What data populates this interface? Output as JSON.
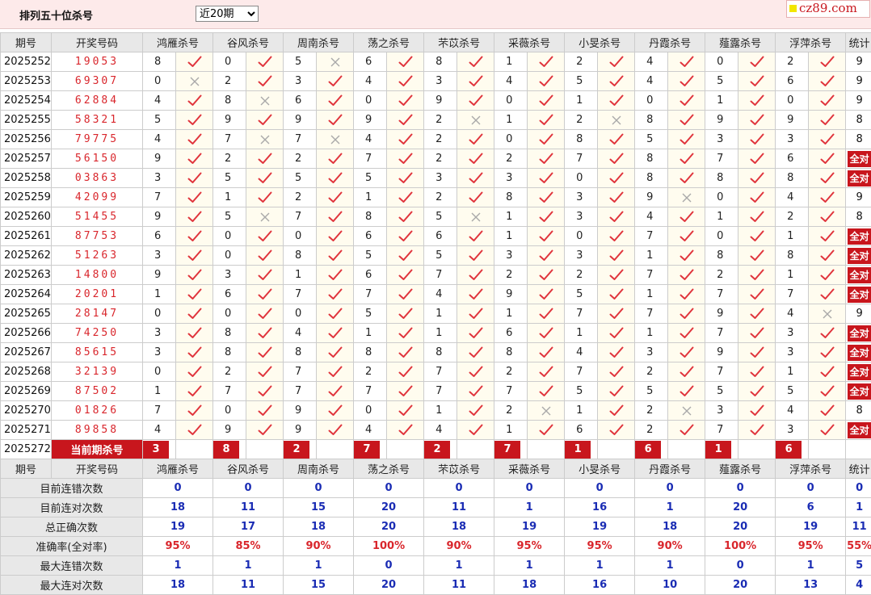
{
  "page": {
    "title": "排列五十位杀号",
    "period_select": "近20期",
    "site": "cz89.com"
  },
  "headers": {
    "period": "期号",
    "number": "开奖号码",
    "experts": [
      "鸿雁杀号",
      "谷风杀号",
      "周南杀号",
      "荡之杀号",
      "芣苡杀号",
      "采薇杀号",
      "小旻杀号",
      "丹霞杀号",
      "薤露杀号",
      "浮萍杀号"
    ],
    "stat": "统计"
  },
  "rows": [
    {
      "period": "2025252",
      "number": "19053",
      "kills": [
        8,
        0,
        5,
        6,
        8,
        1,
        2,
        4,
        0,
        2
      ],
      "hits": [
        1,
        1,
        0,
        1,
        1,
        1,
        1,
        1,
        1,
        1
      ],
      "stat": "9"
    },
    {
      "period": "2025253",
      "number": "69307",
      "kills": [
        0,
        2,
        3,
        4,
        3,
        4,
        5,
        4,
        5,
        6
      ],
      "hits": [
        0,
        1,
        1,
        1,
        1,
        1,
        1,
        1,
        1,
        1
      ],
      "stat": "9"
    },
    {
      "period": "2025254",
      "number": "62884",
      "kills": [
        4,
        8,
        6,
        0,
        9,
        0,
        1,
        0,
        1,
        0
      ],
      "hits": [
        1,
        0,
        1,
        1,
        1,
        1,
        1,
        1,
        1,
        1
      ],
      "stat": "9"
    },
    {
      "period": "2025255",
      "number": "58321",
      "kills": [
        5,
        9,
        9,
        9,
        2,
        1,
        2,
        8,
        9,
        9
      ],
      "hits": [
        1,
        1,
        1,
        1,
        0,
        1,
        0,
        1,
        1,
        1
      ],
      "stat": "8"
    },
    {
      "period": "2025256",
      "number": "79775",
      "kills": [
        4,
        7,
        7,
        4,
        2,
        0,
        8,
        5,
        3,
        3
      ],
      "hits": [
        1,
        0,
        0,
        1,
        1,
        1,
        1,
        1,
        1,
        1
      ],
      "stat": "8"
    },
    {
      "period": "2025257",
      "number": "56150",
      "kills": [
        9,
        2,
        2,
        7,
        2,
        2,
        7,
        8,
        7,
        6
      ],
      "hits": [
        1,
        1,
        1,
        1,
        1,
        1,
        1,
        1,
        1,
        1
      ],
      "stat": "全对"
    },
    {
      "period": "2025258",
      "number": "03863",
      "kills": [
        3,
        5,
        5,
        5,
        3,
        3,
        0,
        8,
        8,
        8
      ],
      "hits": [
        1,
        1,
        1,
        1,
        1,
        1,
        1,
        1,
        1,
        1
      ],
      "stat": "全对"
    },
    {
      "period": "2025259",
      "number": "42099",
      "kills": [
        7,
        1,
        2,
        1,
        2,
        8,
        3,
        9,
        0,
        4
      ],
      "hits": [
        1,
        1,
        1,
        1,
        1,
        1,
        1,
        0,
        1,
        1
      ],
      "stat": "9"
    },
    {
      "period": "2025260",
      "number": "51455",
      "kills": [
        9,
        5,
        7,
        8,
        5,
        1,
        3,
        4,
        1,
        2
      ],
      "hits": [
        1,
        0,
        1,
        1,
        0,
        1,
        1,
        1,
        1,
        1
      ],
      "stat": "8"
    },
    {
      "period": "2025261",
      "number": "87753",
      "kills": [
        6,
        0,
        0,
        6,
        6,
        1,
        0,
        7,
        0,
        1
      ],
      "hits": [
        1,
        1,
        1,
        1,
        1,
        1,
        1,
        1,
        1,
        1
      ],
      "stat": "全对"
    },
    {
      "period": "2025262",
      "number": "51263",
      "kills": [
        3,
        0,
        8,
        5,
        5,
        3,
        3,
        1,
        8,
        8
      ],
      "hits": [
        1,
        1,
        1,
        1,
        1,
        1,
        1,
        1,
        1,
        1
      ],
      "stat": "全对"
    },
    {
      "period": "2025263",
      "number": "14800",
      "kills": [
        9,
        3,
        1,
        6,
        7,
        2,
        2,
        7,
        2,
        1
      ],
      "hits": [
        1,
        1,
        1,
        1,
        1,
        1,
        1,
        1,
        1,
        1
      ],
      "stat": "全对"
    },
    {
      "period": "2025264",
      "number": "20201",
      "kills": [
        1,
        6,
        7,
        7,
        4,
        9,
        5,
        1,
        7,
        7
      ],
      "hits": [
        1,
        1,
        1,
        1,
        1,
        1,
        1,
        1,
        1,
        1
      ],
      "stat": "全对"
    },
    {
      "period": "2025265",
      "number": "28147",
      "kills": [
        0,
        0,
        0,
        5,
        1,
        1,
        7,
        7,
        9,
        4
      ],
      "hits": [
        1,
        1,
        1,
        1,
        1,
        1,
        1,
        1,
        1,
        0
      ],
      "stat": "9"
    },
    {
      "period": "2025266",
      "number": "74250",
      "kills": [
        3,
        8,
        4,
        1,
        1,
        6,
        1,
        1,
        7,
        3
      ],
      "hits": [
        1,
        1,
        1,
        1,
        1,
        1,
        1,
        1,
        1,
        1
      ],
      "stat": "全对"
    },
    {
      "period": "2025267",
      "number": "85615",
      "kills": [
        3,
        8,
        8,
        8,
        8,
        8,
        4,
        3,
        9,
        3
      ],
      "hits": [
        1,
        1,
        1,
        1,
        1,
        1,
        1,
        1,
        1,
        1
      ],
      "stat": "全对"
    },
    {
      "period": "2025268",
      "number": "32139",
      "kills": [
        0,
        2,
        7,
        2,
        7,
        2,
        7,
        2,
        7,
        1
      ],
      "hits": [
        1,
        1,
        1,
        1,
        1,
        1,
        1,
        1,
        1,
        1
      ],
      "stat": "全对"
    },
    {
      "period": "2025269",
      "number": "87502",
      "kills": [
        1,
        7,
        7,
        7,
        7,
        7,
        5,
        5,
        5,
        5
      ],
      "hits": [
        1,
        1,
        1,
        1,
        1,
        1,
        1,
        1,
        1,
        1
      ],
      "stat": "全对"
    },
    {
      "period": "2025270",
      "number": "01826",
      "kills": [
        7,
        0,
        9,
        0,
        1,
        2,
        1,
        2,
        3,
        4
      ],
      "hits": [
        1,
        1,
        1,
        1,
        1,
        0,
        1,
        0,
        1,
        1
      ],
      "stat": "8"
    },
    {
      "period": "2025271",
      "number": "89858",
      "kills": [
        4,
        9,
        9,
        4,
        4,
        1,
        6,
        2,
        7,
        3
      ],
      "hits": [
        1,
        1,
        1,
        1,
        1,
        1,
        1,
        1,
        1,
        1
      ],
      "stat": "全对"
    }
  ],
  "current": {
    "period": "2025272",
    "label": "当前期杀号",
    "kills": [
      3,
      8,
      2,
      7,
      2,
      7,
      1,
      6,
      1,
      6
    ]
  },
  "stats": [
    {
      "label": "目前连错次数",
      "values": [
        "0",
        "0",
        "0",
        "0",
        "0",
        "0",
        "0",
        "0",
        "0",
        "0",
        "0"
      ],
      "tone": "b"
    },
    {
      "label": "目前连对次数",
      "values": [
        "18",
        "11",
        "15",
        "20",
        "11",
        "1",
        "16",
        "1",
        "20",
        "6",
        "1"
      ],
      "tone": "b"
    },
    {
      "label": "总正确次数",
      "values": [
        "19",
        "17",
        "18",
        "20",
        "18",
        "19",
        "19",
        "18",
        "20",
        "19",
        "11"
      ],
      "tone": "b"
    },
    {
      "label": "准确率(全对率)",
      "values": [
        "95%",
        "85%",
        "90%",
        "100%",
        "90%",
        "95%",
        "95%",
        "90%",
        "100%",
        "95%",
        "55%"
      ],
      "tone": "r"
    },
    {
      "label": "最大连错次数",
      "values": [
        "1",
        "1",
        "1",
        "0",
        "1",
        "1",
        "1",
        "1",
        "0",
        "1",
        "5"
      ],
      "tone": "b"
    },
    {
      "label": "最大连对次数",
      "values": [
        "18",
        "11",
        "15",
        "20",
        "11",
        "18",
        "16",
        "10",
        "20",
        "13",
        "4"
      ],
      "tone": "b"
    }
  ],
  "colors": {
    "red": "#c8161d",
    "check": "#e0343c",
    "cross": "#a9a9a9",
    "blue": "#1a2cb4",
    "header_bg": "#e8e8e8",
    "mark_bg": "#fffcef",
    "topbar": "#fdeaea"
  }
}
